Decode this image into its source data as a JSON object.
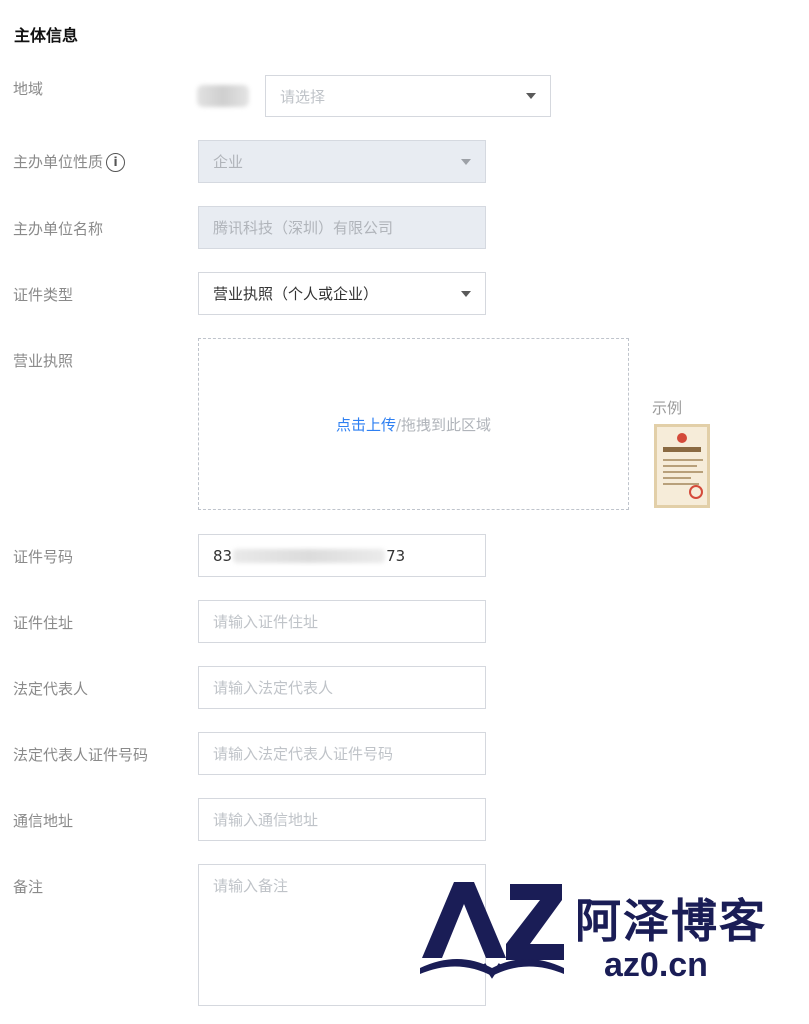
{
  "section_title": "主体信息",
  "fields": {
    "region": {
      "label": "地域",
      "placeholder": "请选择"
    },
    "org_type": {
      "label": "主办单位性质",
      "value": "企业"
    },
    "org_name": {
      "label": "主办单位名称",
      "value": "腾讯科技（深圳）有限公司"
    },
    "cert_type": {
      "label": "证件类型",
      "value": "营业执照（个人或企业）"
    },
    "license": {
      "label": "营业执照",
      "upload_link": "点击上传",
      "upload_rest": "/拖拽到此区域",
      "example_label": "示例"
    },
    "cert_number": {
      "label": "证件号码",
      "value_start": "83",
      "value_end": "73"
    },
    "cert_address": {
      "label": "证件住址",
      "placeholder": "请输入证件住址"
    },
    "legal_rep": {
      "label": "法定代表人",
      "placeholder": "请输入法定代表人"
    },
    "legal_rep_id": {
      "label": "法定代表人证件号码",
      "placeholder": "请输入法定代表人证件号码"
    },
    "mail_address": {
      "label": "通信地址",
      "placeholder": "请输入通信地址"
    },
    "remarks": {
      "label": "备注",
      "placeholder": "请输入备注"
    }
  },
  "watermark": {
    "logo_text": "AZ",
    "name": "阿泽博客",
    "url": "az0.cn"
  },
  "colors": {
    "link": "#2d7ff2",
    "watermark": "#1a1d56",
    "disabled_bg": "#e8ecf2"
  }
}
